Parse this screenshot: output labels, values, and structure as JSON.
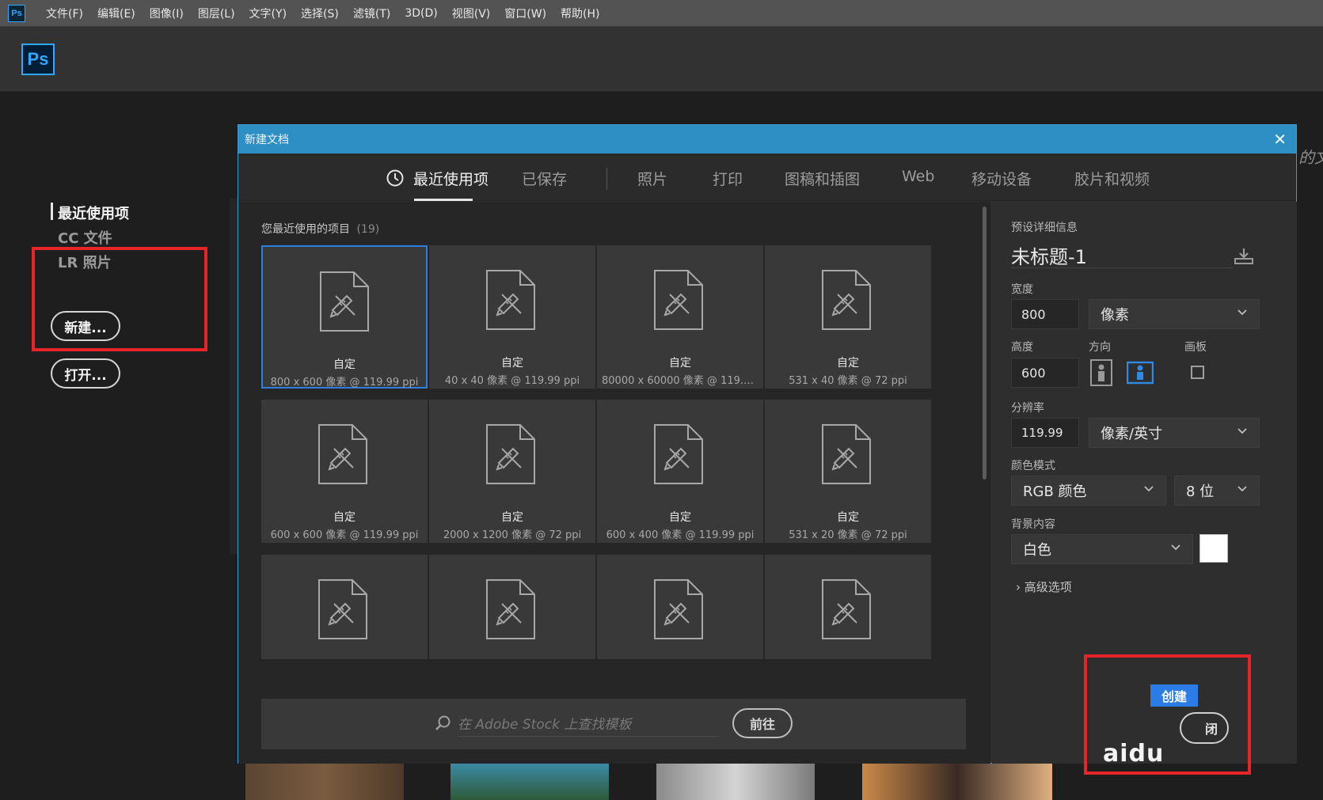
{
  "menubar": {
    "app_icon": "Ps",
    "items": [
      "文件(F)",
      "编辑(E)",
      "图像(I)",
      "图层(L)",
      "文字(Y)",
      "选择(S)",
      "滤镜(T)",
      "3D(D)",
      "视图(V)",
      "窗口(W)",
      "帮助(H)"
    ]
  },
  "app_logo": "Ps",
  "leftnav": {
    "items": [
      "最近使用项",
      "CC 文件",
      "LR 照片"
    ],
    "new_button": "新建...",
    "open_button": "打开..."
  },
  "dialog": {
    "title": "新建文档",
    "close_glyph": "✕",
    "tabs": [
      "最近使用项",
      "已保存",
      "照片",
      "打印",
      "图稿和插图",
      "Web",
      "移动设备",
      "胶片和视频"
    ],
    "recent_header": "您最近使用的项目",
    "recent_count": "(19)",
    "tiles": [
      {
        "name": "自定",
        "dims": "800 x 600 像素 @ 119.99 ppi"
      },
      {
        "name": "自定",
        "dims": "40 x 40 像素 @ 119.99 ppi"
      },
      {
        "name": "自定",
        "dims": "80000 x 60000 像素 @ 119.9..."
      },
      {
        "name": "自定",
        "dims": "531 x 40 像素 @ 72 ppi"
      },
      {
        "name": "自定",
        "dims": "600 x 600 像素 @ 119.99 ppi"
      },
      {
        "name": "自定",
        "dims": "2000 x 1200 像素 @ 72 ppi"
      },
      {
        "name": "自定",
        "dims": "600 x 400 像素 @ 119.99 ppi"
      },
      {
        "name": "自定",
        "dims": "531 x 20 像素 @ 72 ppi"
      },
      {
        "name": "",
        "dims": ""
      },
      {
        "name": "",
        "dims": ""
      },
      {
        "name": "",
        "dims": ""
      },
      {
        "name": "",
        "dims": ""
      }
    ],
    "search_placeholder": "在 Adobe Stock 上查找模板",
    "goto_button": "前往",
    "details": {
      "section_title": "预设详细信息",
      "doc_name": "未标题-1",
      "width_label": "宽度",
      "width_value": "800",
      "width_unit": "像素",
      "height_label": "高度",
      "height_value": "600",
      "orientation_label": "方向",
      "artboard_label": "画板",
      "resolution_label": "分辨率",
      "resolution_value": "119.99",
      "resolution_unit": "像素/英寸",
      "color_mode_label": "颜色模式",
      "color_mode_value": "RGB 颜色",
      "bit_depth_value": "8 位",
      "background_label": "背景内容",
      "background_value": "白色",
      "background_color": "#ffffff",
      "advanced_options": "高级选项",
      "create_button": "创建",
      "close_button": "闭"
    }
  },
  "watermark": "aidu",
  "edge_text": "的文",
  "colors": {
    "accent": "#2e8fc4",
    "selection": "#2f7fe0",
    "highlight": "#e8242b",
    "ps_blue": "#31a8ff"
  }
}
